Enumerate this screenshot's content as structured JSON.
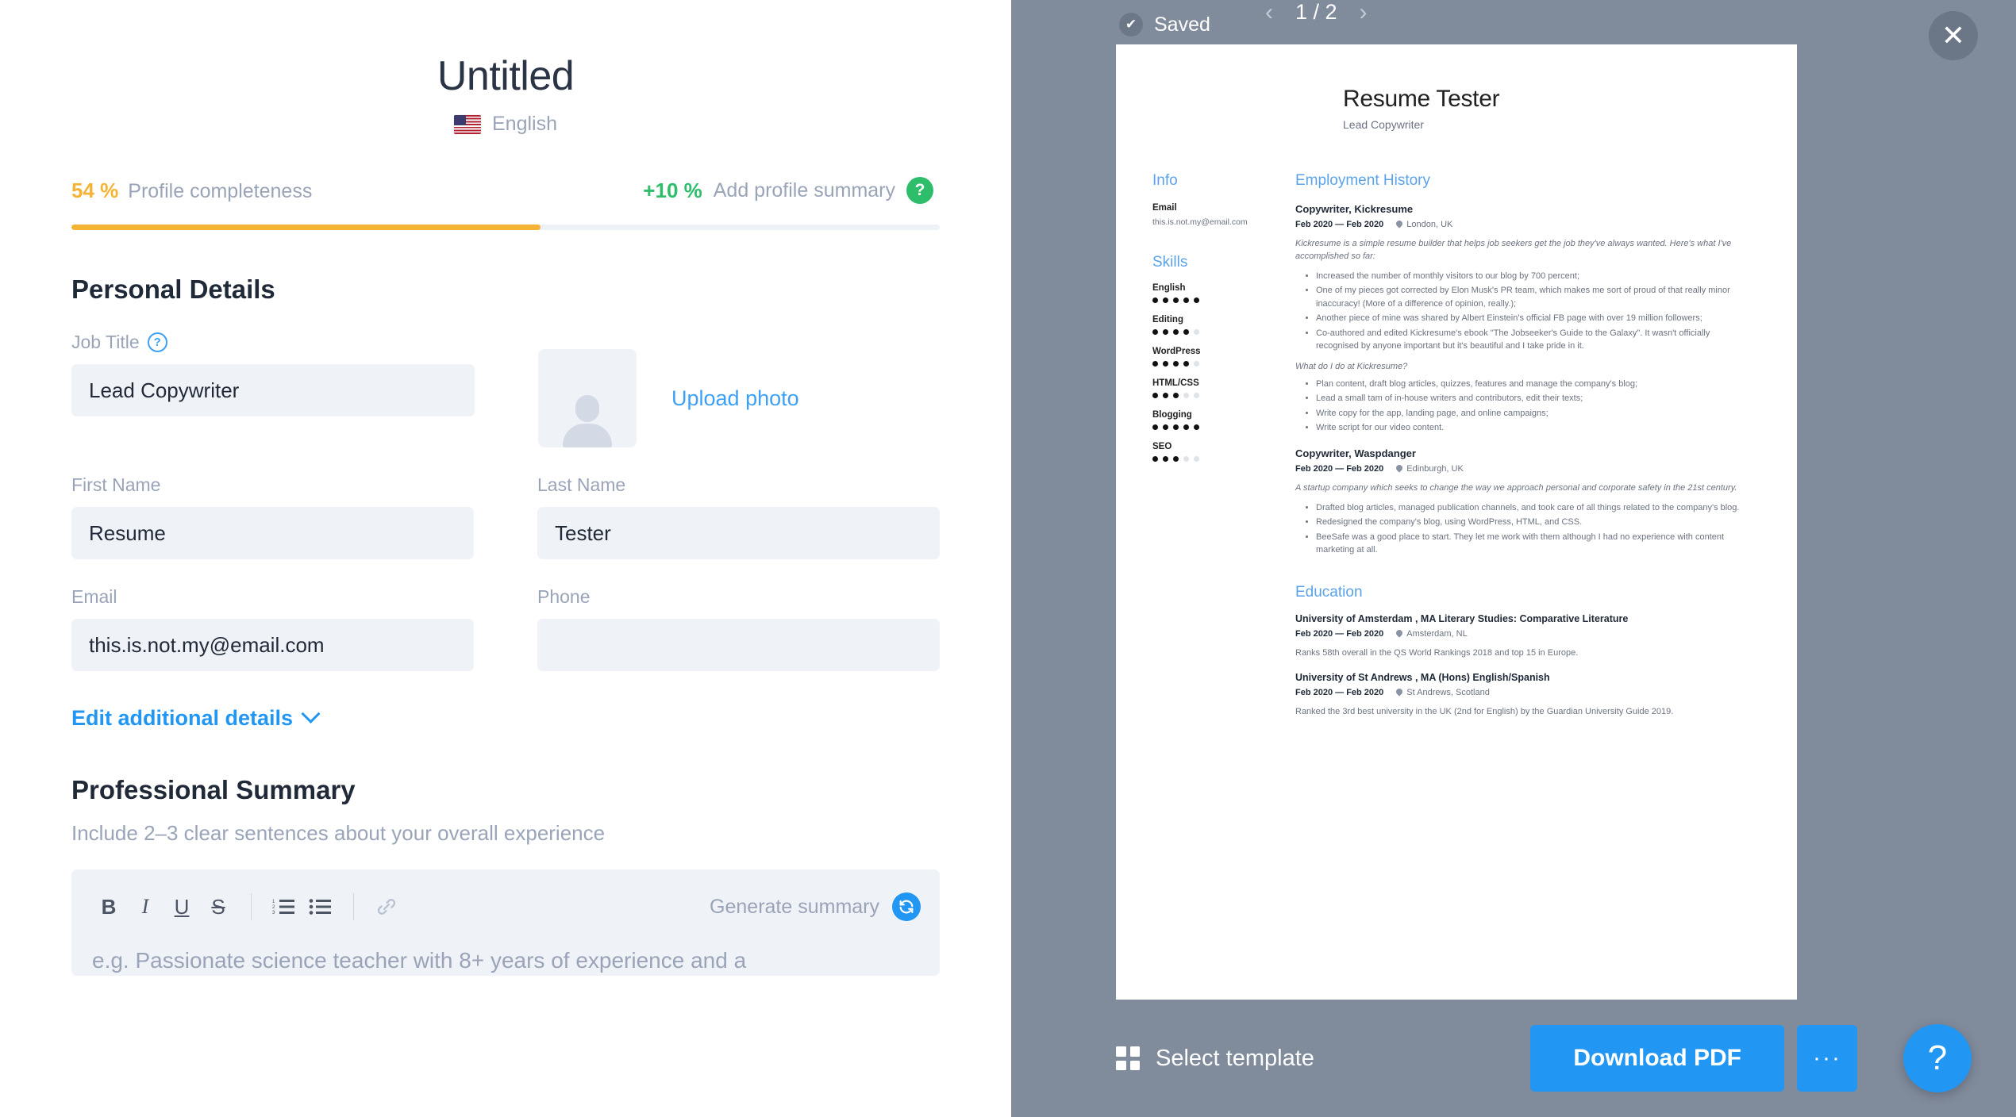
{
  "editor": {
    "document_title": "Untitled",
    "language": {
      "label": "English",
      "flag": "us-flag-icon"
    },
    "completeness": {
      "percent_label": "54 %",
      "percent_value": 54,
      "label": "Profile completeness",
      "bonus_label": "+10 %",
      "bonus_text": "Add profile summary",
      "help_glyph": "?"
    },
    "personal_details": {
      "heading": "Personal Details",
      "job_title": {
        "label": "Job Title",
        "value": "Lead Copywriter",
        "hint_glyph": "?"
      },
      "photo": {
        "upload_label": "Upload photo"
      },
      "first_name": {
        "label": "First Name",
        "value": "Resume"
      },
      "last_name": {
        "label": "Last Name",
        "value": "Tester"
      },
      "email": {
        "label": "Email",
        "value": "this.is.not.my@email.com"
      },
      "phone": {
        "label": "Phone",
        "value": ""
      },
      "edit_additional": "Edit additional details"
    },
    "professional_summary": {
      "heading": "Professional Summary",
      "hint": "Include 2–3 clear sentences about your overall experience",
      "toolbar": {
        "bold": "B",
        "italic": "I",
        "underline": "U",
        "strikethrough": "S",
        "ordered_list": "ordered-list-icon",
        "bullet_list": "bullet-list-icon",
        "link": "link-icon",
        "generate_label": "Generate summary",
        "generate_icon": "refresh-icon"
      },
      "placeholder": "e.g. Passionate science teacher with 8+ years of experience and a"
    }
  },
  "preview": {
    "status": {
      "saved_label": "Saved",
      "check_glyph": "✔"
    },
    "pager": {
      "prev": "‹",
      "next": "›",
      "count": "1 / 2"
    },
    "close_glyph": "✕",
    "bottom": {
      "select_template": "Select template",
      "download_pdf": "Download PDF",
      "more": "···",
      "help": "?"
    },
    "resume": {
      "name": "Resume Tester",
      "role": "Lead Copywriter",
      "info": {
        "title": "Info",
        "email_label": "Email",
        "email_value": "this.is.not.my@email.com"
      },
      "skills": {
        "title": "Skills",
        "items": [
          {
            "name": "English",
            "level": 5
          },
          {
            "name": "Editing",
            "level": 4
          },
          {
            "name": "WordPress",
            "level": 4
          },
          {
            "name": "HTML/CSS",
            "level": 3
          },
          {
            "name": "Blogging",
            "level": 5
          },
          {
            "name": "SEO",
            "level": 3
          }
        ],
        "max": 5
      },
      "employment": {
        "title": "Employment History",
        "jobs": [
          {
            "title": "Copywriter, Kickresume",
            "date": "Feb 2020 — Feb 2020",
            "location": "London, UK",
            "intro": "Kickresume is a simple resume builder that helps job seekers get the job they've always wanted. Here's what I've accomplished so far:",
            "bullets": [
              "Increased the number of monthly visitors to our blog by 700 percent;",
              "One of my pieces got corrected by Elon Musk's PR team, which makes me sort of proud of that really minor inaccuracy! (More of a difference of opinion, really.);",
              "Another piece of mine was shared by Albert Einstein's official FB page with over 19 million followers;",
              "Co-authored and edited Kickresume's ebook \"The Jobseeker's Guide to the Galaxy\". It wasn't officially recognised by anyone important but it's beautiful and I take pride in it."
            ],
            "question": "What do I do at Kickresume?",
            "bullets2": [
              "Plan content, draft blog articles, quizzes, features and manage the company's blog;",
              "Lead a small tam of in-house writers and contributors, edit their texts;",
              "Write copy for the app, landing page, and online campaigns;",
              "Write script for our video content."
            ]
          },
          {
            "title": "Copywriter, Waspdanger",
            "date": "Feb 2020 — Feb 2020",
            "location": "Edinburgh, UK",
            "intro": "A startup company which seeks to change the way we approach personal and corporate safety in the 21st century.",
            "bullets": [
              "Drafted blog articles, managed publication channels, and took care of all things related to the company's blog.",
              "Redesigned the company's blog, using WordPress, HTML, and CSS.",
              "BeeSafe was a good place to start. They let me work with them although I had no experience with content marketing at all."
            ]
          }
        ]
      },
      "education": {
        "title": "Education",
        "items": [
          {
            "title": "University of Amsterdam , MA Literary Studies: Comparative Literature",
            "date": "Feb 2020 — Feb 2020",
            "location": "Amsterdam, NL",
            "note": "Ranks 58th overall in the QS World Rankings 2018 and top 15 in Europe."
          },
          {
            "title": "University of St Andrews , MA (Hons) English/Spanish",
            "date": "Feb 2020 — Feb 2020",
            "location": "St Andrews, Scotland",
            "note": "Ranked the 3rd best university in the UK (2nd for English) by the Guardian University Guide 2019."
          }
        ]
      }
    }
  },
  "colors": {
    "accent_blue": "#2196f3",
    "progress_orange": "#f5b335",
    "bonus_green": "#2ebd6b",
    "preview_bg": "#808b9c",
    "field_bg": "#eff2f7",
    "muted_text": "#9aa4b8",
    "resume_heading": "#5ba3e8"
  }
}
